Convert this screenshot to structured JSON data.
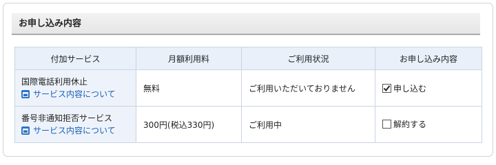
{
  "section": {
    "title": "お申し込み内容"
  },
  "table": {
    "headers": [
      "付加サービス",
      "月額利用料",
      "ご利用状況",
      "お申し込み内容"
    ],
    "rows": [
      {
        "service_name": "国際電話利用休止",
        "service_link": "サービス内容について",
        "monthly_fee": "無料",
        "status": "ご利用いただいておりません",
        "action_label": "申し込む",
        "action_checked": true
      },
      {
        "service_name": "番号非通知拒否サービス",
        "service_link": "サービス内容について",
        "monthly_fee": "300円(税込330円)",
        "status": "ご利用中",
        "action_label": "解約する",
        "action_checked": false
      }
    ]
  },
  "colors": {
    "header_bg": "#e9f0fa",
    "service_cell_bg": "#eef3fb",
    "link": "#1a5fb4",
    "link_icon": "#2a72c8",
    "border": "#c9d3e1"
  },
  "icons": {
    "link_icon": "window-icon",
    "checked": "checkmark-icon"
  }
}
